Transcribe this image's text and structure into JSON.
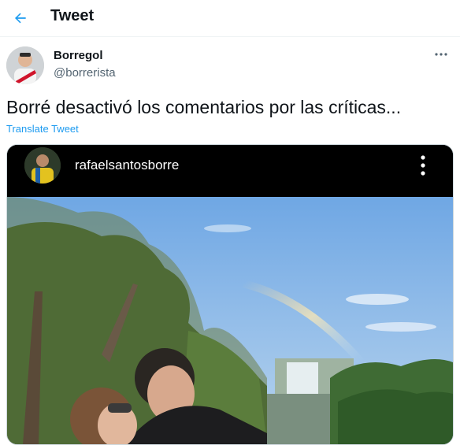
{
  "header": {
    "title": "Tweet",
    "back_icon": "arrow-left-icon",
    "accent": "#1d9bf0"
  },
  "tweet": {
    "author_name": "Borregol",
    "author_handle": "@borrerista",
    "text": "Borré desactivó los comentarios por las críticas...",
    "translate_label": "Translate Tweet",
    "more_icon": "more-horizontal-icon"
  },
  "embedded_post": {
    "username": "rafaelsantosborre",
    "more_icon": "more-vertical-icon"
  }
}
